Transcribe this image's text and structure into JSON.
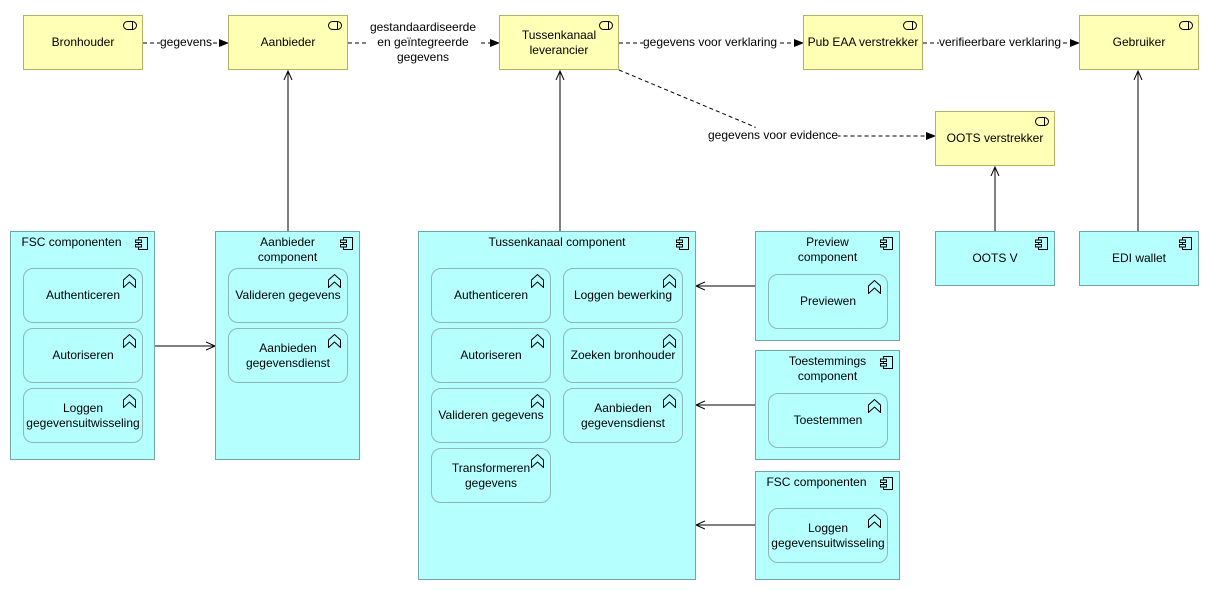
{
  "colors": {
    "service_fill": "#ffffb5",
    "component_fill": "#b5ffff",
    "line": "#000000"
  },
  "services": {
    "bronhouder": "Bronhouder",
    "aanbieder": "Aanbieder",
    "tussenkanaal": "Tussenkanaal\nleverancier",
    "pub_eaa": "Pub EAA verstrekker",
    "gebruiker": "Gebruiker",
    "oots": "OOTS verstrekker"
  },
  "flows": {
    "f1": "gegevens",
    "f2": "gestandaardiseerde\nen geïntegreerde\ngegevens",
    "f3": "gegevens voor verklaring",
    "f4": "verifieerbare verklaring",
    "f5": "gegevens voor evidence"
  },
  "components": {
    "fsc_left": {
      "title": "FSC componenten",
      "functions": [
        "Authenticeren",
        "Autoriseren",
        "Loggen\ngegevensuitwisseling"
      ]
    },
    "aanbieder": {
      "title": "Aanbieder\ncomponent",
      "functions": [
        "Valideren gegevens",
        "Aanbieden\ngegevensdienst"
      ]
    },
    "tussenkanaal": {
      "title": "Tussenkanaal component",
      "functions": [
        "Authenticeren",
        "Autoriseren",
        "Valideren gegevens",
        "Transformeren\ngegevens",
        "Loggen bewerking",
        "Zoeken bronhouder",
        "Aanbieden\ngegevensdienst"
      ]
    },
    "preview": {
      "title": "Preview\ncomponent",
      "functions": [
        "Previewen"
      ]
    },
    "toestemmings": {
      "title": "Toestemmings\ncomponent",
      "functions": [
        "Toestemmen"
      ]
    },
    "fsc_right": {
      "title": "FSC componenten",
      "functions": [
        "Loggen\ngegevensuitwisseling"
      ]
    },
    "oots_v": {
      "title": "OOTS V"
    },
    "edi_wallet": {
      "title": "EDI wallet"
    }
  }
}
